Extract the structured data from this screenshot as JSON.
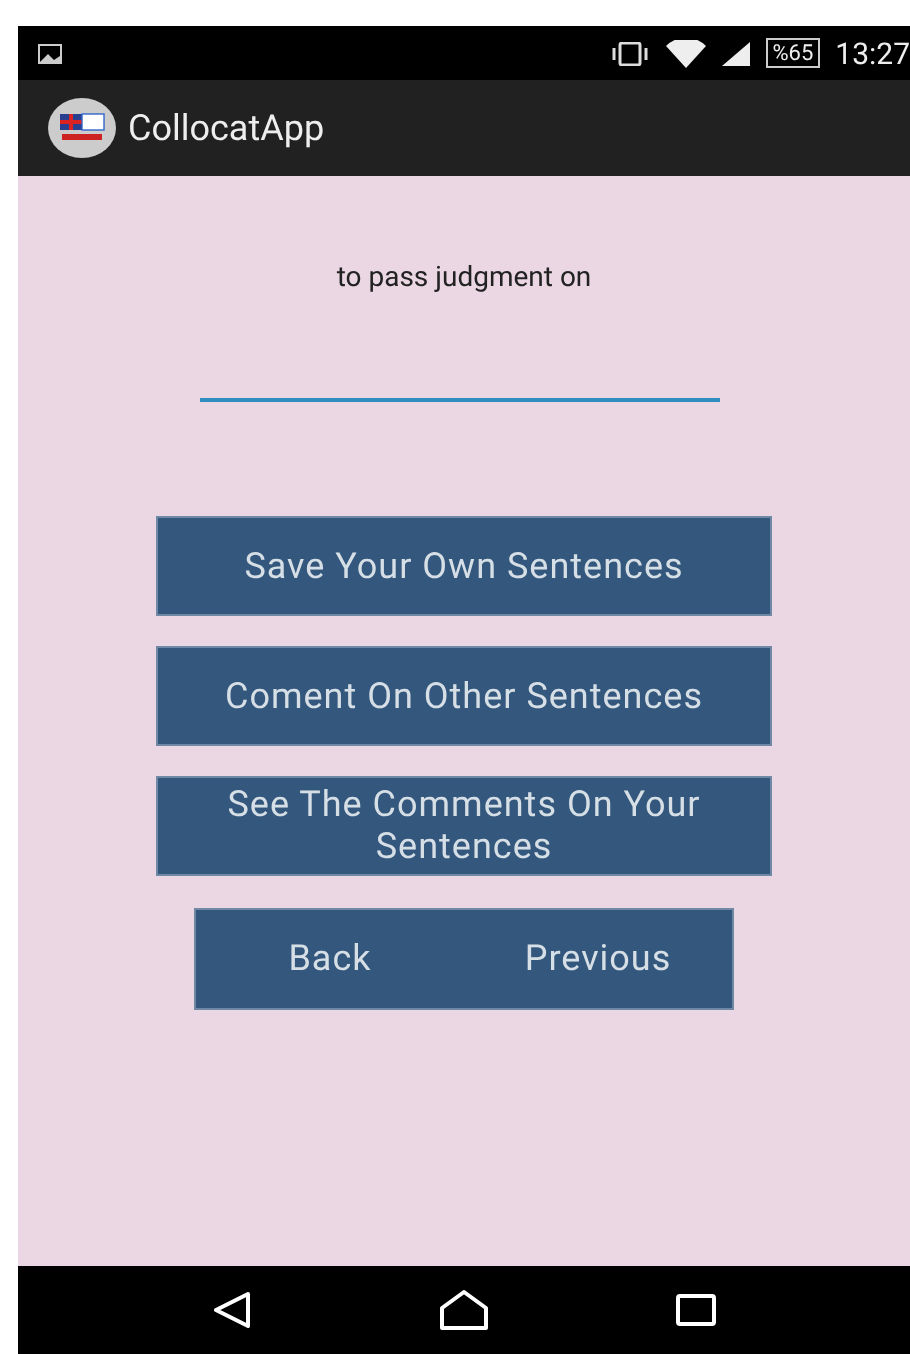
{
  "status_bar": {
    "battery": "%65",
    "time": "13:27"
  },
  "app_bar": {
    "title": "CollocatApp"
  },
  "prompt": "to pass judgment on",
  "buttons": [
    {
      "label": "Save Your Own Sentences"
    },
    {
      "label": "Coment On Other Sentences"
    },
    {
      "label": "See The Comments On Your Sentences"
    }
  ],
  "nav_buttons": [
    {
      "label": "Back"
    },
    {
      "label": "Previous"
    }
  ]
}
